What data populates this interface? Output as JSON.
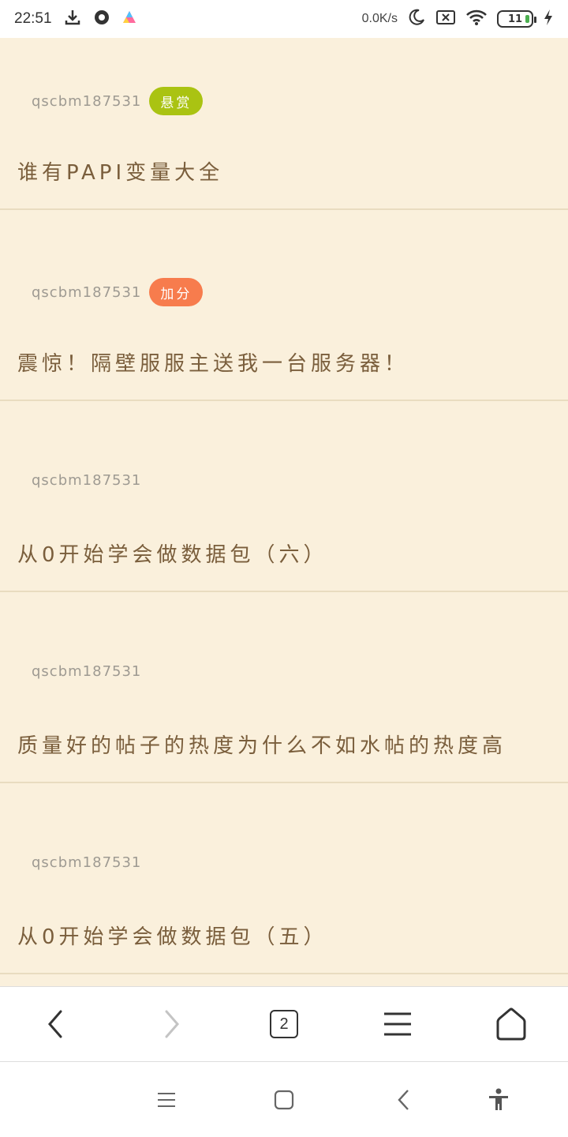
{
  "status_bar": {
    "time": "22:51",
    "net_speed": "0.0K/s",
    "battery": "11",
    "icons": [
      "download-icon",
      "record-icon",
      "app-triangle-icon",
      "moon-icon",
      "sim-off-icon",
      "wifi-icon",
      "charging-icon"
    ]
  },
  "posts": [
    {
      "author": "qscbm187531",
      "tag": "悬赏",
      "tag_color": "#aac312",
      "title": "谁有PAPI变量大全"
    },
    {
      "author": "qscbm187531",
      "tag": "加分",
      "tag_color": "#f77c4d",
      "title": "震惊！隔壁服服主送我一台服务器！"
    },
    {
      "author": "qscbm187531",
      "tag": "",
      "title": "从0开始学会做数据包（六）"
    },
    {
      "author": "qscbm187531",
      "tag": "",
      "title": "质量好的帖子的热度为什么不如水帖的热度高"
    },
    {
      "author": "qscbm187531",
      "tag": "",
      "title": "从0开始学会做数据包（五）"
    }
  ],
  "toolbar": {
    "back": "back-icon",
    "forward": "forward-icon",
    "tab_count": "2",
    "menu": "menu-icon",
    "home": "home-icon"
  },
  "system_nav": [
    "recents-icon",
    "home-square-icon",
    "back-chevron-icon",
    "accessibility-icon"
  ],
  "colors": {
    "background": "#faf0dc",
    "title": "#7a5e3c",
    "author": "#9e9a92"
  }
}
